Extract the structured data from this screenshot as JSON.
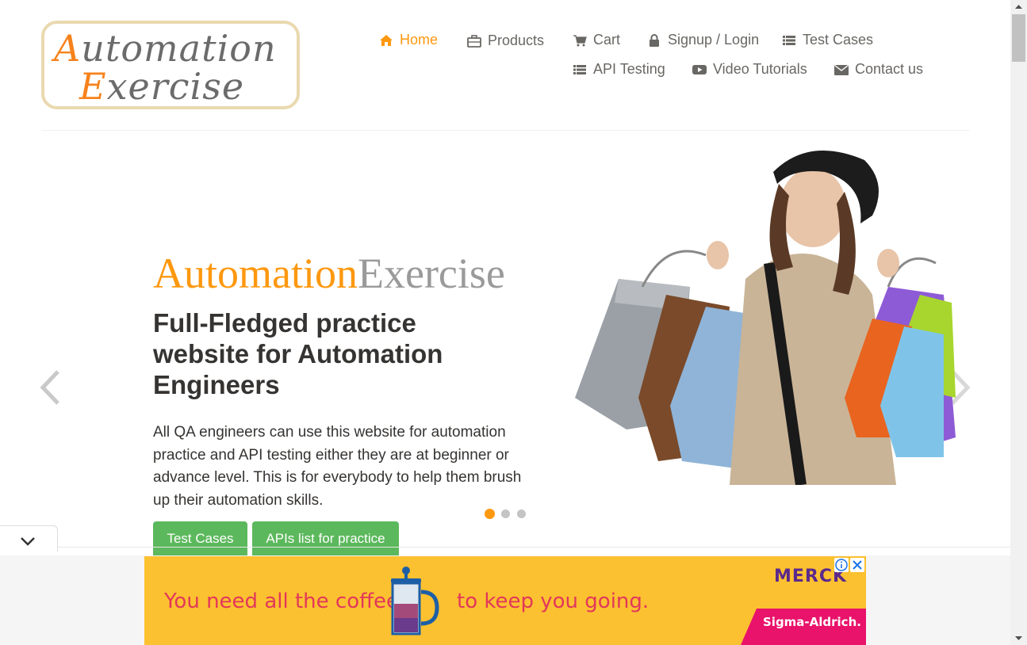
{
  "logo": {
    "line1_cap": "A",
    "line1_rest": "utomation",
    "line2_cap": "E",
    "line2_rest": "xercise"
  },
  "nav": {
    "home": "Home",
    "products": "Products",
    "cart": "Cart",
    "signup": "Signup / Login",
    "test_cases": "Test Cases",
    "api_testing": "API Testing",
    "video": "Video Tutorials",
    "contact": "Contact us"
  },
  "slide": {
    "title_a": "Automation",
    "title_b": "Exercise",
    "heading": "Full-Fledged practice website for Automation Engineers",
    "description": "All QA engineers can use this website for automation practice and API testing either they are at beginner or advance level. This is for everybody to help them brush up their automation skills.",
    "btn_test_cases": "Test Cases",
    "btn_apis": "APIs list for practice",
    "active_dot": 1,
    "dot_count": 3
  },
  "ad": {
    "text1": "You need all the coffee",
    "text2": "to keep you going.",
    "brand": "MERCK",
    "sub": "Sigma-Aldrich."
  },
  "colors": {
    "accent": "#fe980f",
    "button": "#5cb85c",
    "ad_bg": "#fcc130",
    "ad_text": "#e2375a"
  }
}
